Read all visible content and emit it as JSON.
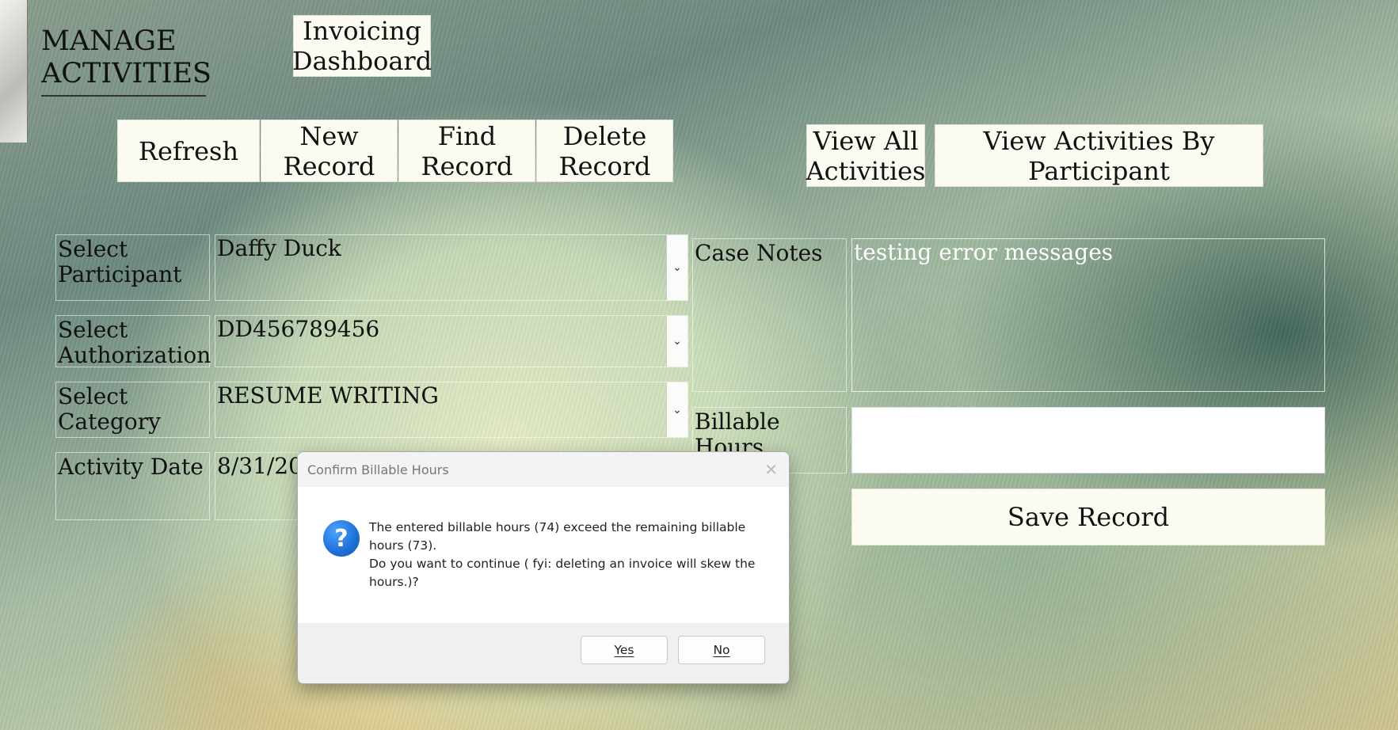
{
  "header": {
    "title_line1": "MANAGE",
    "title_line2": "ACTIVITIES",
    "invoicing_line1": "Invoicing",
    "invoicing_line2": "Dashboard"
  },
  "toolbar": {
    "refresh": "Refresh",
    "new_line1": "New",
    "new_line2": "Record",
    "find_line1": "Find",
    "find_line2": "Record",
    "delete_line1": "Delete",
    "delete_line2": "Record",
    "view_all_line1": "View All",
    "view_all_line2": "Activities",
    "view_by_line1": "View Activities By",
    "view_by_line2": "Participant"
  },
  "form": {
    "participant_label_line1": "Select",
    "participant_label_line2": "Participant",
    "participant_value": "Daffy Duck",
    "authorization_label_line1": "Select",
    "authorization_label_line2": "Authorization",
    "authorization_value": "DD456789456",
    "category_label_line1": "Select",
    "category_label_line2": "Category",
    "category_value": "RESUME WRITING",
    "activity_date_label": "Activity Date",
    "activity_date_value": "8/31/20",
    "case_notes_label": "Case Notes",
    "case_notes_value": "testing error messages",
    "billable_hours_label": "Billable Hours",
    "billable_hours_value": "",
    "save": "Save Record"
  },
  "dialog": {
    "title": "Confirm Billable Hours",
    "close": "✕",
    "icon": "question-icon",
    "icon_glyph": "?",
    "message_line1": "The entered billable hours (74) exceed the remaining billable",
    "message_line2": "hours (73).",
    "message_line3": "Do you want to continue ( fyi: deleting an invoice will skew the",
    "message_line4": "hours.)?",
    "yes": "Yes",
    "no": "No"
  },
  "icons": {
    "dropdown": "⌄"
  }
}
